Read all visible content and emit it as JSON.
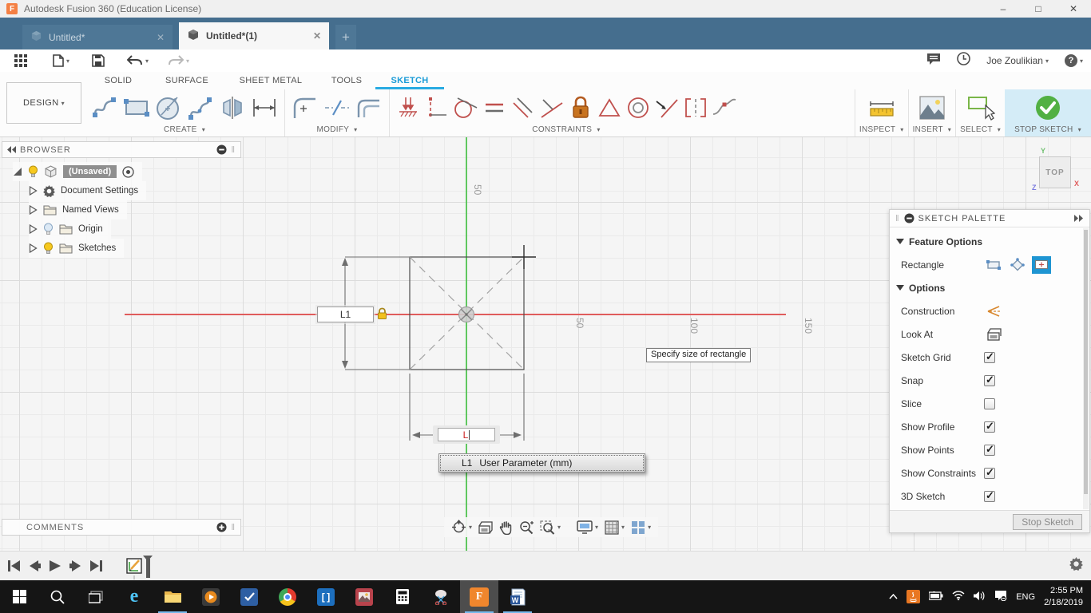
{
  "window": {
    "title": "Autodesk Fusion 360 (Education License)",
    "controls": [
      "minimize",
      "maximize",
      "close"
    ]
  },
  "doc_tabs": {
    "tabs": [
      {
        "label": "Untitled*",
        "active": false
      },
      {
        "label": "Untitled*(1)",
        "active": true
      }
    ],
    "new_tab_icon": "plus"
  },
  "app_toolbar": {
    "left_icons": [
      "grid-menu",
      "file",
      "save",
      "undo",
      "redo"
    ],
    "right_icons": [
      "comments",
      "recent-activity",
      "user-menu",
      "help"
    ],
    "user_name": "Joe Zoulikian"
  },
  "ribbon": {
    "workspace_label": "DESIGN",
    "tabs": [
      {
        "label": "SOLID"
      },
      {
        "label": "SURFACE"
      },
      {
        "label": "SHEET METAL"
      },
      {
        "label": "TOOLS"
      },
      {
        "label": "SKETCH",
        "active": true
      }
    ],
    "groups": {
      "create": {
        "label": "CREATE",
        "icons": [
          "line",
          "rectangle",
          "circle",
          "spline",
          "mirror",
          "sketch-dimension"
        ]
      },
      "modify": {
        "label": "MODIFY",
        "icons": [
          "fillet",
          "trim",
          "offset"
        ]
      },
      "constraints": {
        "label": "CONSTRAINTS",
        "icons": [
          "coincident",
          "vertical-horizontal",
          "tangent",
          "equal",
          "parallel",
          "perpendicular",
          "fix-unfix",
          "midpoint",
          "concentric",
          "collinear",
          "symmetry",
          "curvature"
        ]
      },
      "inspect": {
        "label": "INSPECT",
        "icons": [
          "measure"
        ]
      },
      "insert": {
        "label": "INSERT",
        "icons": [
          "insert-image"
        ]
      },
      "select": {
        "label": "SELECT",
        "icons": [
          "select-window"
        ]
      },
      "stop_sketch": {
        "label": "STOP SKETCH",
        "icons": [
          "finish-sketch-check"
        ]
      }
    }
  },
  "browser": {
    "title": "BROWSER",
    "root": {
      "label": "(Unsaved)",
      "bulb": "on"
    },
    "items": [
      {
        "label": "Document Settings",
        "icon": "gear",
        "bulb": null
      },
      {
        "label": "Named Views",
        "icon": "folder",
        "bulb": null
      },
      {
        "label": "Origin",
        "icon": "folder",
        "bulb": "off"
      },
      {
        "label": "Sketches",
        "icon": "folder",
        "bulb": "on"
      }
    ]
  },
  "comments_panel": {
    "title": "COMMENTS"
  },
  "canvas": {
    "axis_x_labels": [
      "50",
      "100",
      "150"
    ],
    "axis_y_labels": [
      "50"
    ],
    "height_dim_value": "L1",
    "width_dim_value": "L",
    "height_dim_locked": true,
    "tooltip": "Specify size of rectangle",
    "param_popup": {
      "name": "L1",
      "desc": "User Parameter (mm)"
    },
    "viewcube": {
      "face": "TOP",
      "axis_x": "X",
      "axis_y": "Y",
      "axis_z": "Z"
    },
    "nav_icons": [
      "orbit",
      "look-at",
      "pan",
      "zoom",
      "window-zoom",
      "display-settings",
      "grid-settings",
      "viewports"
    ]
  },
  "sketch_palette": {
    "title": "SKETCH PALETTE",
    "feature_section": "Feature Options",
    "rectangle_row": {
      "label": "Rectangle",
      "modes": [
        "2-point-rectangle",
        "3-point-rectangle",
        "center-rectangle"
      ],
      "selected_mode": "center-rectangle"
    },
    "options_section": "Options",
    "tool_rows": [
      {
        "label": "Construction"
      },
      {
        "label": "Look At"
      }
    ],
    "checkbox_rows": [
      {
        "label": "Sketch Grid",
        "checked": true
      },
      {
        "label": "Snap",
        "checked": true
      },
      {
        "label": "Slice",
        "checked": false
      },
      {
        "label": "Show Profile",
        "checked": true
      },
      {
        "label": "Show Points",
        "checked": true
      },
      {
        "label": "Show Constraints",
        "checked": true
      },
      {
        "label": "3D Sketch",
        "checked": true
      }
    ],
    "stop_sketch_button": "Stop Sketch"
  },
  "timeline": {
    "playback_icons": [
      "skip-to-start",
      "step-back",
      "play",
      "step-forward",
      "skip-to-end"
    ],
    "items": [
      "sketch-feature"
    ],
    "settings_icon": "gear"
  },
  "taskbar": {
    "apps": [
      "start",
      "search",
      "task-view",
      "edge",
      "file-explorer",
      "media-player",
      "todo",
      "chrome",
      "code-app",
      "photo-app",
      "calculator",
      "snipping-tool",
      "fusion-360",
      "word"
    ],
    "running_apps": [
      "file-explorer",
      "fusion-360",
      "word"
    ],
    "active_app": "fusion-360",
    "tray": {
      "icons": [
        "chevron-up",
        "java",
        "battery",
        "wifi",
        "volume",
        "action-center"
      ],
      "language": "ENG",
      "time": "2:55 PM",
      "date": "2/18/2019"
    }
  }
}
